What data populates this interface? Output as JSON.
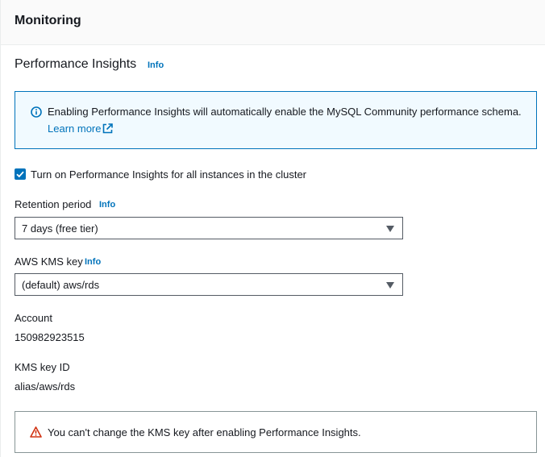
{
  "header": {
    "title": "Monitoring"
  },
  "section": {
    "title": "Performance Insights",
    "info": "Info"
  },
  "info_alert": {
    "message": "Enabling Performance Insights will automatically enable the MySQL Community performance schema.",
    "link": "Learn more"
  },
  "toggle": {
    "label": "Turn on Performance Insights for all instances in the cluster",
    "checked": true
  },
  "retention": {
    "label": "Retention period",
    "info": "Info",
    "value": "7 days (free tier)"
  },
  "kms": {
    "label": "AWS KMS key",
    "info": "Info",
    "value": "(default) aws/rds"
  },
  "account": {
    "label": "Account",
    "value": "150982923515"
  },
  "kms_key_id": {
    "label": "KMS key ID",
    "value": "alias/aws/rds"
  },
  "warning_alert": {
    "message": "You can't change the KMS key after enabling Performance Insights."
  },
  "colors": {
    "link": "#0073bb",
    "info_bg": "#f1faff",
    "warning": "#d13212",
    "text": "#16191f"
  },
  "icons": [
    "info-circle-icon",
    "external-link-icon",
    "check-icon",
    "caret-down-icon",
    "warning-triangle-icon"
  ]
}
